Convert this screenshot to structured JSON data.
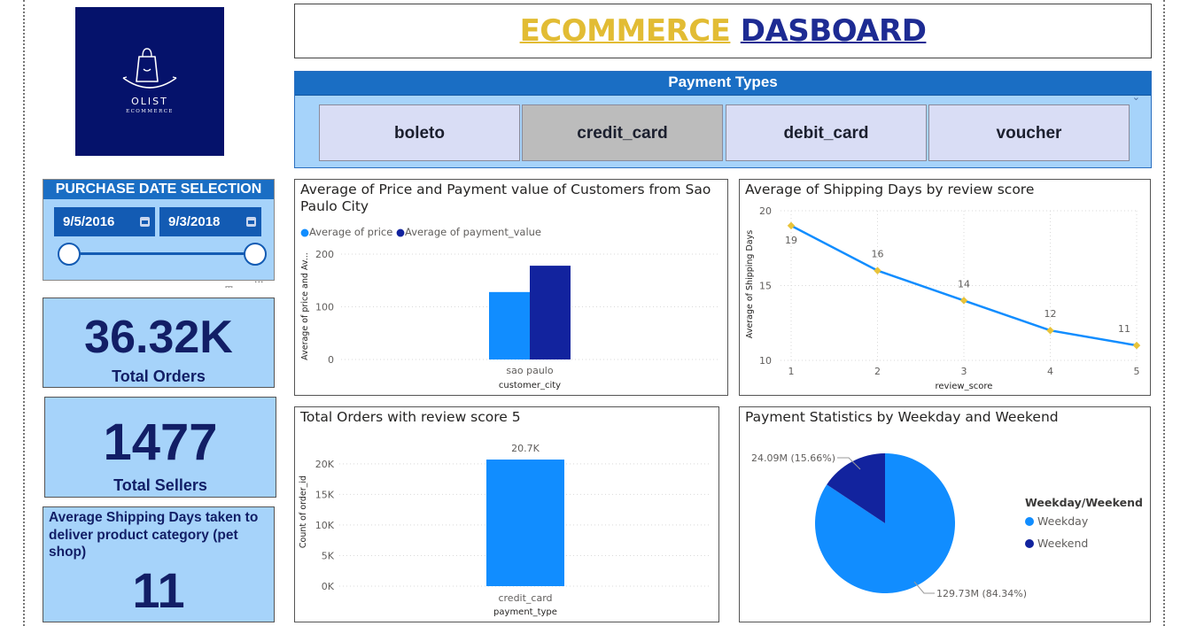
{
  "logo": {
    "brand": "OLIST",
    "tagline": "ECOMMERCE"
  },
  "header": {
    "title_part1": "ECOMMERCE",
    "title_part2": "DASBOARD"
  },
  "payment_slicer": {
    "title": "Payment Types",
    "options": [
      "boleto",
      "credit_card",
      "debit_card",
      "voucher"
    ],
    "selected": "credit_card"
  },
  "date_selection": {
    "title": "PURCHASE DATE SELECTION",
    "start": "9/5/2016",
    "end": "9/3/2018"
  },
  "kpis": {
    "total_orders": {
      "value": "36.32K",
      "label": "Total Orders"
    },
    "total_sellers": {
      "value": "1477",
      "label": "Total Sellers"
    },
    "avg_shipping": {
      "label": "Average Shipping Days taken to deliver product category (pet shop)",
      "value": "11"
    }
  },
  "colors": {
    "light_blue": "#118dff",
    "navy": "#12239e",
    "marker": "#e8c33a",
    "pie_light": "#118dff",
    "pie_dark": "#12239e"
  },
  "chart_data": [
    {
      "type": "bar",
      "title": "Average of Price and Payment value of Customers from Sao Paulo City",
      "legend": [
        "Average of price",
        "Average of payment_value"
      ],
      "xlabel": "customer_city",
      "ylabel": "Average of price and Av...",
      "categories": [
        "sao paulo"
      ],
      "series": [
        {
          "name": "Average of price",
          "values": [
            128
          ]
        },
        {
          "name": "Average of payment_value",
          "values": [
            178
          ]
        }
      ],
      "ylim": [
        0,
        200
      ],
      "yticks": [
        "0",
        "100",
        "200"
      ],
      "grid": true
    },
    {
      "type": "line",
      "title": "Average of Shipping Days by review score",
      "xlabel": "review_score",
      "ylabel": "Average of Shipping Days",
      "x": [
        1,
        2,
        3,
        4,
        5
      ],
      "y": [
        19,
        16,
        14,
        12,
        11
      ],
      "data_labels": [
        "19",
        "16",
        "14",
        "12",
        "11"
      ],
      "xticks": [
        "1",
        "2",
        "3",
        "4",
        "5"
      ],
      "yticks": [
        "10",
        "15",
        "20"
      ],
      "ylim": [
        10,
        20
      ],
      "grid": true
    },
    {
      "type": "bar",
      "title": "Total Orders with review score 5",
      "xlabel": "payment_type",
      "ylabel": "Count of order_id",
      "categories": [
        "credit_card"
      ],
      "values": [
        20700
      ],
      "data_labels": [
        "20.7K"
      ],
      "yticks": [
        "0K",
        "5K",
        "10K",
        "15K",
        "20K"
      ],
      "ylim": [
        0,
        20700
      ],
      "grid": true
    },
    {
      "type": "pie",
      "title": "Payment Statistics by Weekday and Weekend",
      "legend_title": "Weekday/Weekend",
      "legend_position": "right",
      "slices": [
        {
          "name": "Weekday",
          "value": 129.73,
          "percent": 84.34,
          "label": "129.73M (84.34%)"
        },
        {
          "name": "Weekend",
          "value": 24.09,
          "percent": 15.66,
          "label": "24.09M (15.66%)"
        }
      ]
    }
  ]
}
